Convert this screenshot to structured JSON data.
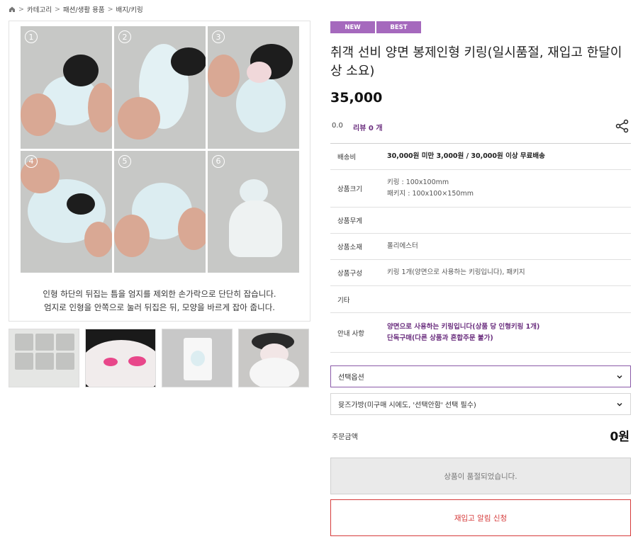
{
  "breadcrumb": {
    "items": [
      "카테고리",
      "패션/생활 용품",
      "배지/키링"
    ]
  },
  "gallery": {
    "step_numbers": [
      "1",
      "2",
      "3",
      "4",
      "5",
      "6"
    ],
    "caption_line1": "인형 하단의 뒤집는 틈을 엄지를 제외한 손가락으로 단단히 잡습니다.",
    "caption_line2": "엄지로 인형을 안쪽으로 눌러 뒤집은 뒤, 모양을 바르게 잡아 줍니다."
  },
  "product": {
    "badges": [
      "NEW",
      "BEST"
    ],
    "title": "취객 선비 양면 봉제인형 키링(일시품절, 재입고 한달이 상 소요)",
    "price": "35,000",
    "rating": "0.0",
    "review_label": "리뷰 0 개"
  },
  "info_rows": [
    {
      "key": "배송비",
      "value1": "30,000원 미만 3,000원 / 30,000원 이상 무료배송",
      "value2": ""
    },
    {
      "key": "상품크기",
      "value1": "키링 : 100x100mm",
      "value2": "패키지 : 100x100×150mm"
    },
    {
      "key": "상품무게",
      "value1": "",
      "value2": ""
    },
    {
      "key": "상품소재",
      "value1": "폴리에스터",
      "value2": ""
    },
    {
      "key": "상품구성",
      "value1": "키링 1개(양면으로 사용하는 키링입니다), 패키지",
      "value2": ""
    },
    {
      "key": "기타",
      "value1": "",
      "value2": ""
    },
    {
      "key": "안내 사항",
      "value1": "양면으로 사용하는 키링입니다(상품 당 인형키링 1개)",
      "value2": "단독구매(다른 상품과 혼합주문 불가)"
    }
  ],
  "options": {
    "option_select": "선택옵션",
    "bag_select": "뮷즈가방(미구매 시에도, '선택안함' 선택 필수)"
  },
  "order": {
    "total_label": "주문금액",
    "total_value": "0원",
    "soldout_label": "상품이 품절되었습니다.",
    "restock_label": "재입고 알림 신청"
  },
  "colors": {
    "badge": "#a569bd",
    "accent_purple": "#6b2f7f",
    "restock_red": "#d63b3b"
  }
}
